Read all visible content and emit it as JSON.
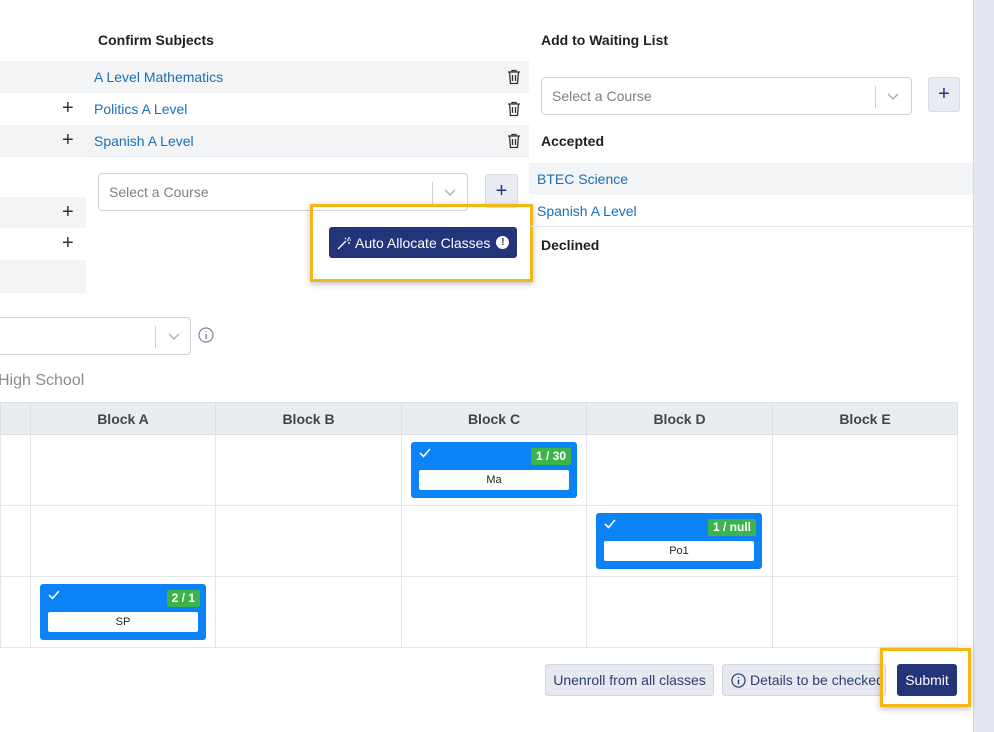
{
  "confirm": {
    "heading": "Confirm Subjects",
    "subjects": [
      {
        "name": "A Level Mathematics"
      },
      {
        "name": "Politics A Level"
      },
      {
        "name": "Spanish A Level"
      }
    ],
    "select_placeholder": "Select a Course",
    "auto_allocate_label": "Auto Allocate Classes",
    "auto_allocate_badge": "!"
  },
  "waiting": {
    "heading": "Add to Waiting List",
    "select_placeholder": "Select a Course",
    "add_label": "+"
  },
  "accepted": {
    "heading": "Accepted",
    "items": [
      "BTEC Science",
      "Spanish A Level"
    ]
  },
  "declined": {
    "heading": "Declined"
  },
  "school": {
    "name_fragment": "High School"
  },
  "timetable": {
    "blocks": [
      "Block A",
      "Block B",
      "Block C",
      "Block D",
      "Block E"
    ],
    "cards": [
      {
        "row": 0,
        "block": "Block C",
        "badge": "1 / 30",
        "code": "Ma"
      },
      {
        "row": 1,
        "block": "Block D",
        "badge": "1 / null",
        "code": "Po1"
      },
      {
        "row": 2,
        "block": "Block A",
        "badge": "2 / 1",
        "code": "SP"
      }
    ]
  },
  "actions": {
    "unenroll_label": "Unenroll from all classes",
    "details_label": "Details to be checked",
    "submit_label": "Submit"
  },
  "colors": {
    "primary": "#24347a",
    "card_blue": "#0b82f5",
    "badge_green": "#3cb44a",
    "highlight": "#f3b718",
    "link": "#1a6fb5"
  }
}
